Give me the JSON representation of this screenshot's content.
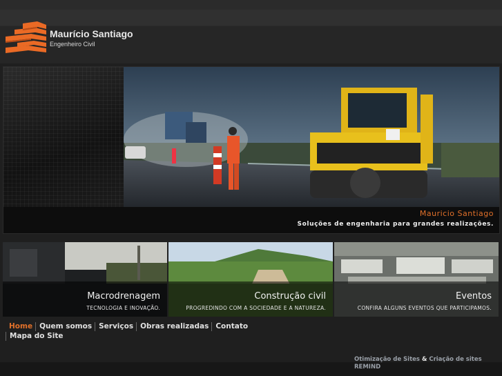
{
  "brand": {
    "name": "Maurício Santiago",
    "subtitle": "Engenheiro Civil"
  },
  "banner": {
    "title": "Mauricio Santiago",
    "tagline": "Soluções de engenharia para grandes realizações."
  },
  "cards": [
    {
      "title": "Macrodrenagem",
      "subtitle": "TECNOLOGIA E INOVAÇÃO."
    },
    {
      "title": "Construção civil",
      "subtitle": "PROGREDINDO COM A SOCIEDADE E A NATUREZA."
    },
    {
      "title": "Eventos",
      "subtitle": "CONFIRA ALGUNS EVENTOS QUE PARTICIPAMOS."
    }
  ],
  "nav": {
    "items": [
      "Home",
      "Quem somos",
      "Serviços",
      "Obras realizadas",
      "Contato",
      "Mapa do Site"
    ],
    "active": "Home"
  },
  "footer": {
    "credit_part1": "Otimização de Sites",
    "credit_amp": "&",
    "credit_part2": "Criação de sites",
    "credit_company": "REMIND"
  },
  "colors": {
    "accent": "#e0702a",
    "background": "#1f1f1f"
  }
}
